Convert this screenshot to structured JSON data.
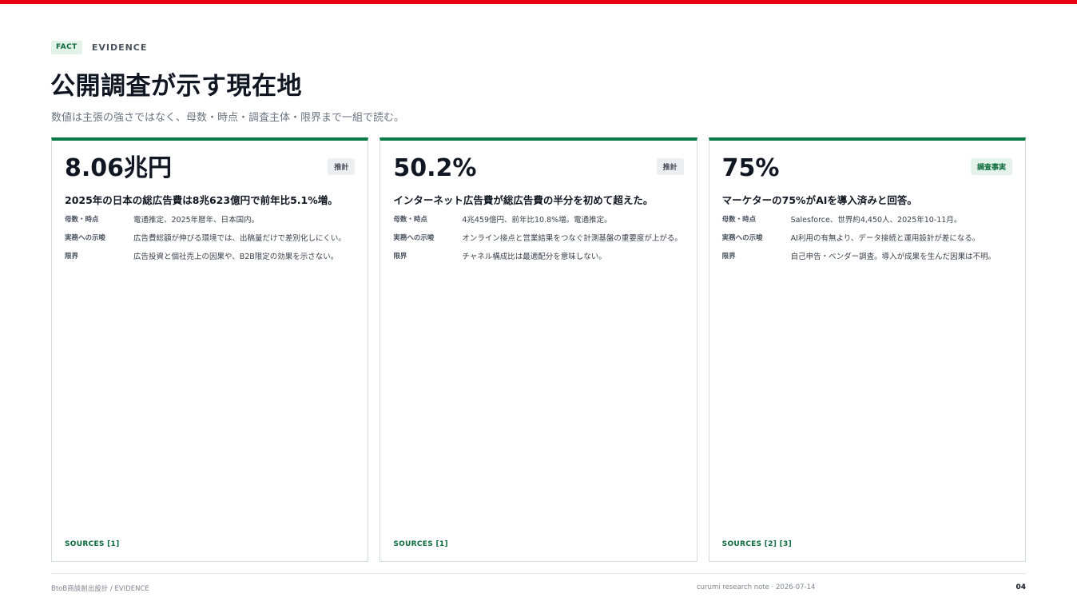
{
  "header": {
    "tag_fact": "FACT",
    "tag_evidence": "EVIDENCE",
    "title": "公開調査が示す現在地",
    "subtitle": "数値は主張の強さではなく、母数・時点・調査主体・限界まで一組で読む。"
  },
  "row_labels": {
    "base": "母数・時点",
    "implication": "実務への示唆",
    "limit": "限界"
  },
  "cards": [
    {
      "value": "8.06兆円",
      "badge": "推計",
      "claim": "2025年の日本の総広告費は8兆623億円で前年比5.1%増。",
      "base": "電通推定、2025年暦年、日本国内。",
      "implication": "広告費総額が伸びる環境では、出稿量だけで差別化しにくい。",
      "limit": "広告投資と個社売上の因果や、B2B限定の効果を示さない。",
      "sources": "SOURCES [1]"
    },
    {
      "value": "50.2%",
      "badge": "推計",
      "claim": "インターネット広告費が総広告費の半分を初めて超えた。",
      "base": "4兆459億円、前年比10.8%増。電通推定。",
      "implication": "オンライン接点と営業結果をつなぐ計測基盤の重要度が上がる。",
      "limit": "チャネル構成比は最適配分を意味しない。",
      "sources": "SOURCES [1]"
    },
    {
      "value": "75%",
      "badge": "調査事実",
      "claim": "マーケターの75%がAIを導入済みと回答。",
      "base": "Salesforce、世界約4,450人、2025年10-11月。",
      "implication": "AI利用の有無より、データ接続と運用設計が差になる。",
      "limit": "自己申告・ベンダー調査。導入が成果を生んだ因果は不明。",
      "sources": "SOURCES [2] [3]"
    }
  ],
  "footer": {
    "left": "BtoB商談創出設計 / EVIDENCE",
    "middle": "curumi research note · 2026-07-14",
    "page": "04"
  }
}
